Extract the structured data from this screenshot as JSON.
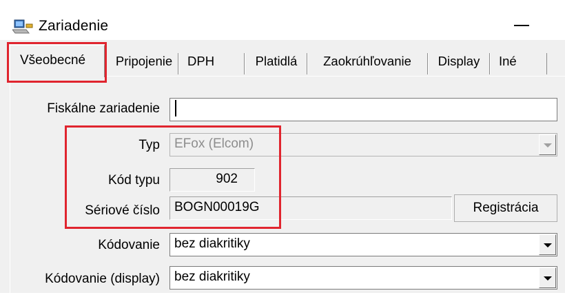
{
  "window": {
    "title": "Zariadenie",
    "minimize_glyph": "—",
    "icon": "computer-icon"
  },
  "tabs": [
    {
      "label": "Všeobecné",
      "active": true
    },
    {
      "label": "Pripojenie"
    },
    {
      "label": "DPH"
    },
    {
      "label": "Platidlá"
    },
    {
      "label": "Zaokrúhľovanie"
    },
    {
      "label": "Display"
    },
    {
      "label": "Iné"
    }
  ],
  "form": {
    "fiskalne_zariadenie": {
      "label": "Fiskálne zariadenie",
      "value": ""
    },
    "typ": {
      "label": "Typ",
      "value": "EFox (Elcom)"
    },
    "kod_typu": {
      "label": "Kód typu",
      "value": "902"
    },
    "seriove_cislo": {
      "label": "Sériové číslo",
      "value": "BOGN00019G"
    },
    "kodovanie": {
      "label": "Kódovanie",
      "value": "bez diakritiky"
    },
    "kodovanie_display": {
      "label": "Kódovanie (display)",
      "value": "bez diakritiky"
    }
  },
  "buttons": {
    "registracia": "Registrácia"
  },
  "colors": {
    "highlight": "#e0242e",
    "face": "#f0f0f0"
  }
}
